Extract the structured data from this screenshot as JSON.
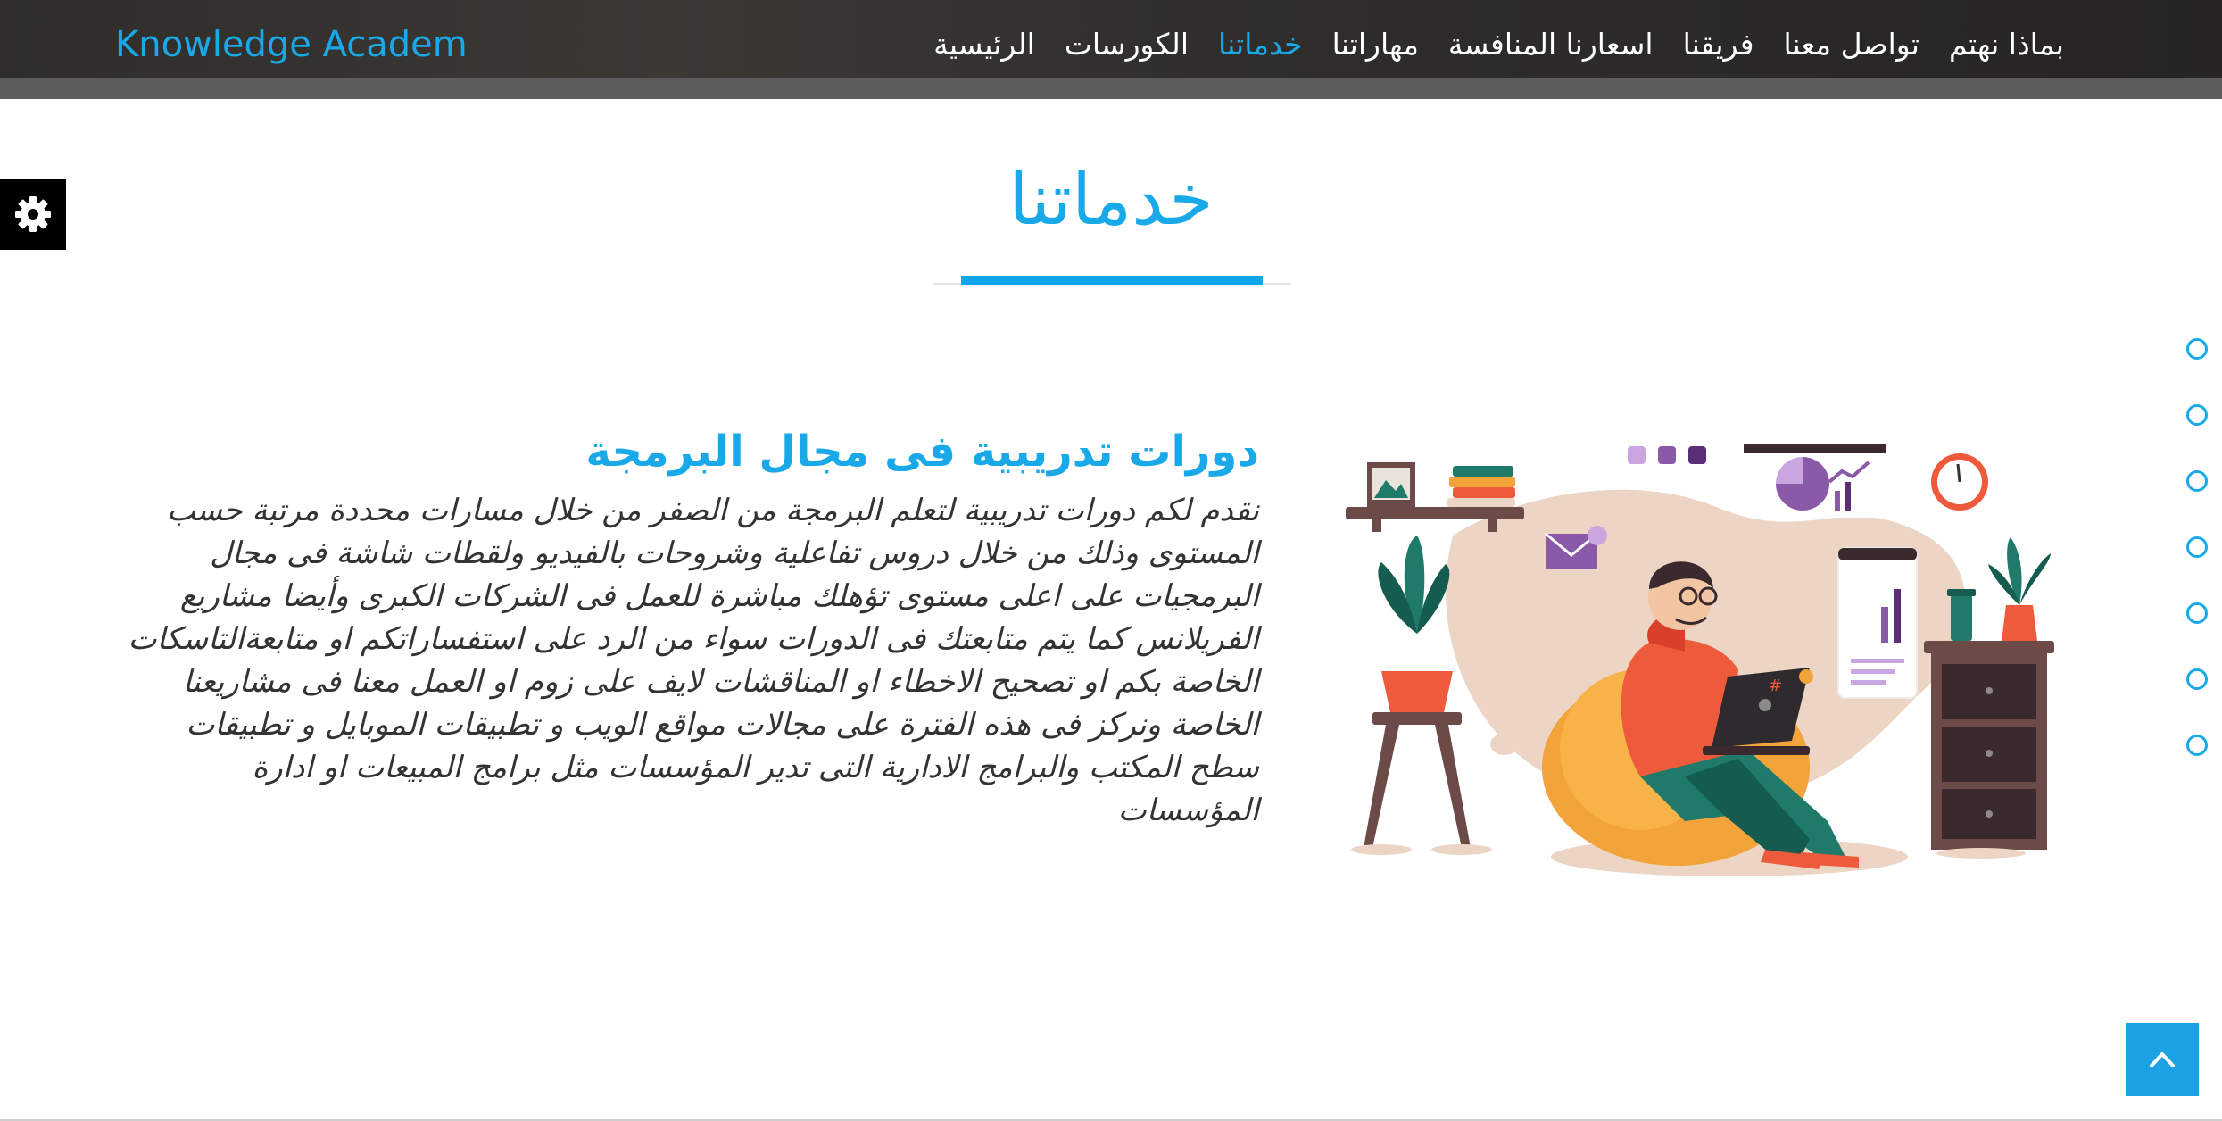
{
  "brand": {
    "name": "Knowledge Academ"
  },
  "nav": {
    "items": [
      {
        "label": "الرئيسية",
        "active": false
      },
      {
        "label": "الكورسات",
        "active": false
      },
      {
        "label": "خدماتنا",
        "active": true
      },
      {
        "label": "مهاراتنا",
        "active": false
      },
      {
        "label": "اسعارنا المنافسة",
        "active": false
      },
      {
        "label": "فريقنا",
        "active": false
      },
      {
        "label": "تواصل معنا",
        "active": false
      },
      {
        "label": "بماذا نهتم",
        "active": false
      }
    ]
  },
  "section": {
    "title": "خدماتنا"
  },
  "content": {
    "heading": "دورات تدريبية فى مجال البرمجة",
    "body": "نقدم لكم دورات تدريبية لتعلم البرمجة من الصفر من خلال مسارات محددة مرتبة حسب المستوى وذلك من خلال دروس تفاعلية وشروحات بالفيديو ولقطات شاشة فى مجال البرمجيات على اعلى مستوى تؤهلك مباشرة للعمل فى الشركات الكبرى وأيضا مشاريع الفريلانس كما يتم متابعتك فى الدورات سواء من الرد على استفساراتكم او متابعةالتاسكات الخاصة بكم او تصحيح الاخطاء او المناقشات لايف على زوم او العمل معنا فى مشاريعنا الخاصة ونركز فى هذه الفترة على مجالات مواقع الويب و تطبيقات الموبايل و تطبيقات سطح المكتب والبرامج الادارية التى تدير المؤسسات مثل برامج المبيعات او ادارة المؤسسات"
  },
  "dot_nav": {
    "count": 7
  },
  "icons": {
    "settings": "gear-icon",
    "back_to_top": "chevron-up-icon",
    "dot": "circle-outline-icon"
  },
  "colors": {
    "accent": "#1aa9e8",
    "navbar": "#2e2d2b",
    "back_to_top": "#1da1e5"
  }
}
